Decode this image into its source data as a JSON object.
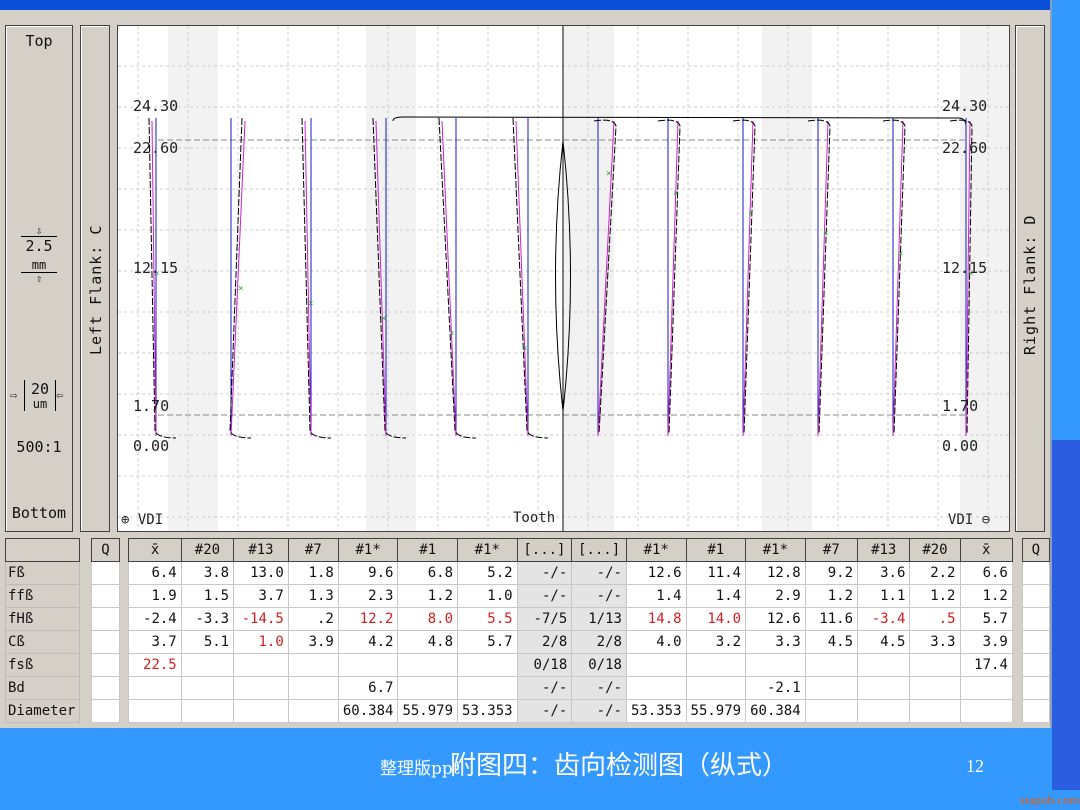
{
  "left_panel": {
    "top": "Top",
    "bottom": "Bottom",
    "scale_mm": "2.5",
    "unit_mm": "mm",
    "scale_um": "20",
    "unit_um": "um",
    "ratio": "500:1"
  },
  "flank_left": "Left Flank: C",
  "flank_right": "Right Flank: D",
  "plot": {
    "y_labels": [
      "24.30",
      "22.60",
      "12.15",
      "1.70",
      "0.00"
    ],
    "bottom_left": "⊕ VDI",
    "bottom_center": "Tooth",
    "bottom_right": "VDI ⊖",
    "colors": {
      "profile": "#000000",
      "reference": "#1a1acc",
      "mean": "#cc22cc",
      "marker": "#22aa22"
    }
  },
  "table": {
    "q_label": "Q",
    "columns": [
      "x̄",
      "#20",
      "#13",
      "#7",
      "#1*",
      "#1",
      "#1*",
      "[...]",
      "[...]",
      "#1*",
      "#1",
      "#1*",
      "#7",
      "#13",
      "#20",
      "x̄"
    ],
    "rows": [
      {
        "label": "Fß",
        "values": [
          "6.4",
          "3.8",
          "13.0",
          "1.8",
          "9.6",
          "6.8",
          "5.2",
          "-/-",
          "-/-",
          "12.6",
          "11.4",
          "12.8",
          "9.2",
          "3.6",
          "2.2",
          "6.6"
        ],
        "red": []
      },
      {
        "label": "ffß",
        "values": [
          "1.9",
          "1.5",
          "3.7",
          "1.3",
          "2.3",
          "1.2",
          "1.0",
          "-/-",
          "-/-",
          "1.4",
          "1.4",
          "2.9",
          "1.2",
          "1.1",
          "1.2",
          "1.2"
        ],
        "red": []
      },
      {
        "label": "fHß",
        "values": [
          "-2.4",
          "-3.3",
          "-14.5",
          ".2",
          "12.2",
          "8.0",
          "5.5",
          "-7/5",
          "1/13",
          "14.8",
          "14.0",
          "12.6",
          "11.6",
          "-3.4",
          ".5",
          "5.7"
        ],
        "red": [
          2,
          4,
          5,
          6,
          9,
          10,
          13,
          14
        ]
      },
      {
        "label": "Cß",
        "values": [
          "3.7",
          "5.1",
          "1.0",
          "3.9",
          "4.2",
          "4.8",
          "5.7",
          "2/8",
          "2/8",
          "4.0",
          "3.2",
          "3.3",
          "4.5",
          "4.5",
          "3.3",
          "3.9"
        ],
        "red": [
          2
        ]
      },
      {
        "label": "fsß",
        "values": [
          "22.5",
          "",
          "",
          "",
          "",
          "",
          "",
          "0/18",
          "0/18",
          "",
          "",
          "",
          "",
          "",
          "",
          "17.4"
        ],
        "red": [
          0
        ]
      },
      {
        "label": "Bd",
        "values": [
          "",
          "",
          "",
          "",
          "6.7",
          "",
          "",
          "-/-",
          "-/-",
          "",
          "",
          "-2.1",
          "",
          "",
          "",
          ""
        ],
        "red": []
      },
      {
        "label": "Diameter",
        "values": [
          "",
          "",
          "",
          "",
          "60.384",
          "55.979",
          "53.353",
          "-/-",
          "-/-",
          "53.353",
          "55.979",
          "60.384",
          "",
          "",
          "",
          ""
        ],
        "red": []
      }
    ]
  },
  "footer": {
    "prefix": "整理版ppt",
    "caption": "附图四：齿向检测图（纵式）",
    "page": "12",
    "watermark": "stapub.com"
  }
}
